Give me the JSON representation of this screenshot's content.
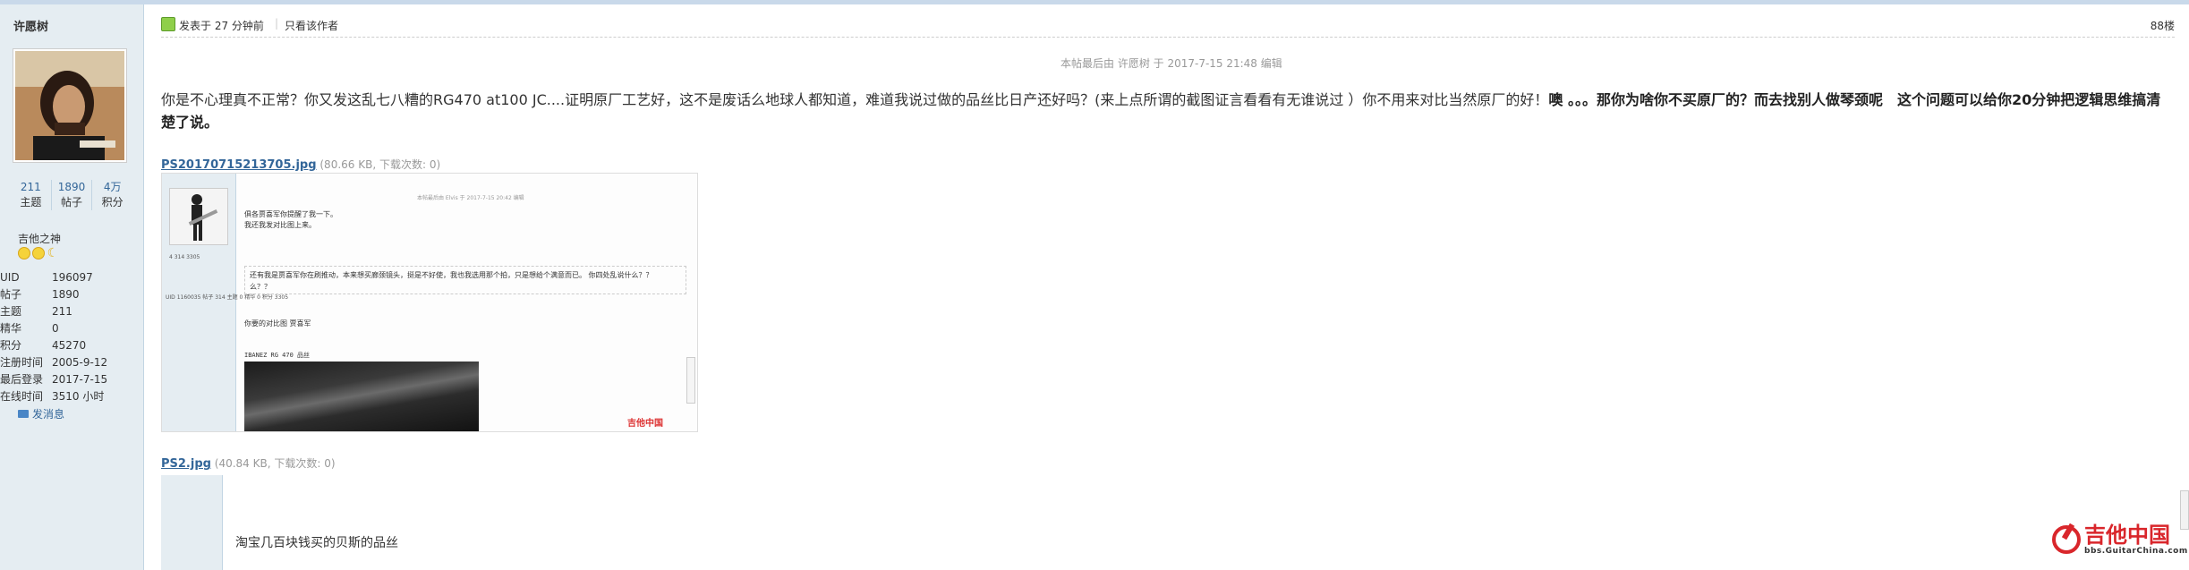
{
  "user": {
    "name": "许愿树",
    "stats": [
      {
        "value": "211",
        "label": "主题"
      },
      {
        "value": "1890",
        "label": "帖子"
      },
      {
        "value": "4万",
        "label": "积分"
      }
    ],
    "title": "吉他之神",
    "info": [
      {
        "key": "UID",
        "value": "196097"
      },
      {
        "key": "帖子",
        "value": "1890"
      },
      {
        "key": "主题",
        "value": "211"
      },
      {
        "key": "精华",
        "value": "0"
      },
      {
        "key": "积分",
        "value": "45270"
      },
      {
        "key": "注册时间",
        "value": "2005-9-12"
      },
      {
        "key": "最后登录",
        "value": "2017-7-15"
      },
      {
        "key": "在线时间",
        "value": "3510 小时"
      }
    ],
    "send_message": "发消息"
  },
  "post": {
    "posted_at": "发表于 27 分钟前",
    "separator": "|",
    "only_author": "只看该作者",
    "floor": "88楼",
    "edit_note": "本帖最后由 许愿树 于 2017-7-15 21:48 编辑",
    "content_normal": "你是不心理真不正常？你又发这乱七八糟的RG470 at100 JC....证明原厂工艺好，这不是废话么地球人都知道，难道我说过做的品丝比日产还好吗？(来上点所谓的截图证言看看有无谁说过 ）你不用来对比当然原厂的好！",
    "content_bold": "噢 。。。那你为啥你不买原厂的？而去找别人做琴颈呢　这个问题可以给你20分钟把逻辑思维搞清楚了说。"
  },
  "attachments": [
    {
      "name": "PS20170715213705.jpg",
      "meta": "(80.66 KB, 下载次数: 0)"
    },
    {
      "name": "PS2.jpg",
      "meta": "(40.84 KB, 下载次数: 0)"
    }
  ],
  "screenshot1": {
    "mini_edit": "本帖最后由 Elvis 于 2017-7-15 20:42 编辑",
    "line1": "俱各贾喜军你提醒了我一下。",
    "line2": "我还我发对比图上来。",
    "quote1": "还有我是贾喜军你在刷推动，本来想买廊颈镜头，挺是不好使，我也我选用那个拍，只是想给个满意而已。 你四处乱说什么？？",
    "quote2": "么？？",
    "line3": "你要的对比图 贾喜军",
    "caption": "IBANEZ RG 470  品丝",
    "mini_stats": "4   314   3305",
    "mini_info": "UID 1160035  帖子 314  主题 0  精华 0  积分 3305",
    "watermark": "吉他中国"
  },
  "screenshot2": {
    "caption": "淘宝几百块钱买的贝斯的品丝"
  },
  "site_watermark": {
    "main": "吉他中国",
    "sub": "bbs.GuitarChina.com"
  },
  "colors": {
    "sidebar_bg": "#e5edf2",
    "link_blue": "#336699",
    "brand_red": "#d9262b"
  }
}
